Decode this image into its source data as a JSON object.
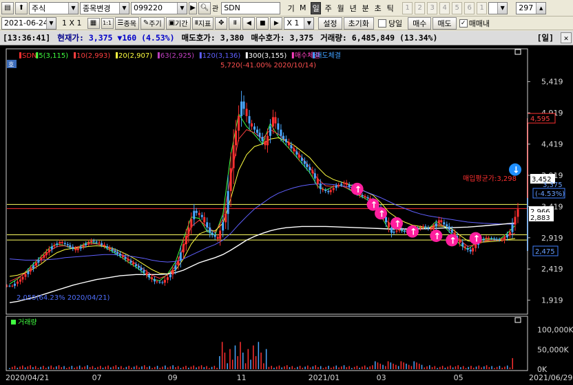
{
  "toolbar1": {
    "market": "주식",
    "change_label": "종목변경",
    "code": "099220",
    "ticker": "SDN",
    "mode_chars": [
      "기",
      "M"
    ],
    "periods": [
      {
        "label": "일",
        "active": true
      },
      {
        "label": "주",
        "active": false
      },
      {
        "label": "월",
        "active": false
      },
      {
        "label": "년",
        "active": false
      },
      {
        "label": "분",
        "active": false
      },
      {
        "label": "초",
        "active": false
      },
      {
        "label": "틱",
        "active": false
      }
    ],
    "nums": [
      "1",
      "2",
      "3",
      "4",
      "5",
      "6",
      "1"
    ],
    "count": "297"
  },
  "toolbar2": {
    "date": "2021-06-24",
    "layout": "1 X 1",
    "labels": [
      "종목",
      "주기",
      "기간",
      "지표"
    ],
    "ratio": "X 1",
    "settings": "설정",
    "reset": "초기화",
    "sameday": "당일",
    "buy": "매수",
    "sell": "매도",
    "trade": "매매내"
  },
  "status": {
    "time": "[13:36:41]",
    "price_label": "현재가:",
    "price": "3,375",
    "change": "▼160",
    "change_pct": "(4.53%)",
    "ask_label": "매도호가:",
    "ask": "3,380",
    "bid_label": "매수호가:",
    "bid": "3,375",
    "vol_label": "거래량:",
    "vol": "6,485,849",
    "vol_pct": "(13.34%)",
    "period": "[일]"
  },
  "legend": {
    "tag": "호",
    "items": [
      {
        "text": "SDN",
        "color": "#ff3030"
      },
      {
        "text": "5(3,115)",
        "color": "#40ff40"
      },
      {
        "text": "10(2,993)",
        "color": "#ff4040"
      },
      {
        "text": "20(2,907)",
        "color": "#ffff40"
      },
      {
        "text": "63(2,925)",
        "color": "#c040c0"
      },
      {
        "text": "120(3,136)",
        "color": "#6060ff"
      },
      {
        "text": "300(3,155)",
        "color": "#ffffff"
      },
      {
        "text": "매수체결",
        "color": "#ff40c0"
      },
      {
        "text": "매도체결",
        "color": "#40a0ff"
      }
    ]
  },
  "annotations": {
    "high": "5,720(-41.00% 2020/10/14)",
    "low": "2,055(64.23% 2020/04/21)",
    "avgline": "매입평균가:3,298",
    "volume_label": "거래량"
  },
  "chart_data": {
    "type": "candlestick",
    "title": "",
    "y_ticks": [
      "5,419",
      "4,919",
      "4,419",
      "3,919",
      "3,419",
      "2,919",
      "2,419",
      "1,919"
    ],
    "right_labels": {
      "max": "4,595",
      "line1": "3,452",
      "current": "3,375",
      "current_pct": "(-4.53%)",
      "line2": "2,966",
      "line3": "2,883",
      "min": "2,475"
    },
    "x_labels": [
      "2020/04/21",
      "07",
      "09",
      "11",
      "2021/01",
      "03",
      "05",
      "2021/06/29"
    ],
    "volume_ticks": [
      "100,000K",
      "50,000K",
      "0K"
    ],
    "ylim": [
      1750,
      5900
    ],
    "price_series": [
      2150,
      2250,
      2380,
      2520,
      2640,
      2780,
      2850,
      2800,
      2720,
      2800,
      2870,
      2830,
      2760,
      2690,
      2610,
      2520,
      2440,
      2320,
      2220,
      2200,
      2330,
      2550,
      2950,
      3350,
      3250,
      3000,
      2900,
      3300,
      4400,
      5100,
      4750,
      4600,
      4400,
      4850,
      4550,
      4400,
      4250,
      4100,
      3950,
      3700,
      3650,
      3750,
      3800,
      3700,
      3600,
      3550,
      3450,
      3250,
      3000,
      3050,
      3000,
      3050,
      3100,
      3050,
      3200,
      3100,
      2950,
      2780,
      2700,
      2860,
      2920,
      2900,
      2880,
      3010,
      3375
    ],
    "series": [
      {
        "name": "5(3,115)",
        "values": [
          2180,
          2260,
          2370,
          2500,
          2620,
          2750,
          2820,
          2790,
          2740,
          2790,
          2850,
          2830,
          2770,
          2700,
          2620,
          2530,
          2450,
          2350,
          2260,
          2230,
          2340,
          2530,
          2900,
          3250,
          3230,
          3020,
          2960,
          3300,
          4250,
          4900,
          4700,
          4570,
          4420,
          4750,
          4540,
          4400,
          4260,
          4110,
          3960,
          3740,
          3680,
          3740,
          3760,
          3690,
          3610,
          3550,
          3460,
          3270,
          3050,
          3060,
          3020,
          3050,
          3090,
          3060,
          3180,
          3100,
          2970,
          2810,
          2730,
          2840,
          2900,
          2900,
          2890,
          2990,
          3115
        ]
      },
      {
        "name": "10(2,993)",
        "values": [
          2220,
          2280,
          2350,
          2460,
          2580,
          2700,
          2780,
          2790,
          2760,
          2780,
          2820,
          2820,
          2790,
          2730,
          2660,
          2580,
          2500,
          2410,
          2320,
          2270,
          2320,
          2460,
          2760,
          3100,
          3200,
          3100,
          3000,
          3220,
          3900,
          4500,
          4650,
          4600,
          4500,
          4650,
          4580,
          4470,
          4340,
          4200,
          4050,
          3860,
          3750,
          3740,
          3750,
          3700,
          3640,
          3580,
          3500,
          3340,
          3150,
          3100,
          3050,
          3050,
          3070,
          3060,
          3140,
          3110,
          3020,
          2880,
          2780,
          2810,
          2860,
          2880,
          2880,
          2950,
          2993
        ]
      },
      {
        "name": "20(2,907)",
        "values": [
          2300,
          2320,
          2360,
          2420,
          2500,
          2600,
          2680,
          2730,
          2750,
          2760,
          2780,
          2790,
          2780,
          2750,
          2700,
          2640,
          2570,
          2490,
          2410,
          2350,
          2340,
          2400,
          2580,
          2820,
          2980,
          3030,
          3030,
          3150,
          3550,
          4000,
          4250,
          4380,
          4420,
          4500,
          4520,
          4470,
          4400,
          4300,
          4200,
          4050,
          3920,
          3850,
          3810,
          3770,
          3720,
          3660,
          3600,
          3480,
          3330,
          3240,
          3170,
          3120,
          3100,
          3080,
          3110,
          3100,
          3060,
          2960,
          2870,
          2850,
          2850,
          2860,
          2870,
          2890,
          2907
        ]
      },
      {
        "name": "120(3,136)",
        "values": [
          2580,
          2570,
          2560,
          2560,
          2560,
          2570,
          2580,
          2600,
          2610,
          2620,
          2630,
          2640,
          2650,
          2650,
          2640,
          2630,
          2610,
          2590,
          2560,
          2540,
          2530,
          2540,
          2580,
          2640,
          2700,
          2760,
          2810,
          2880,
          2990,
          3130,
          3260,
          3380,
          3470,
          3560,
          3630,
          3680,
          3720,
          3750,
          3770,
          3780,
          3780,
          3770,
          3750,
          3730,
          3700,
          3660,
          3610,
          3560,
          3500,
          3440,
          3390,
          3340,
          3300,
          3270,
          3250,
          3230,
          3210,
          3190,
          3170,
          3160,
          3150,
          3145,
          3140,
          3138,
          3136
        ]
      },
      {
        "name": "300(3,155)",
        "values": [
          1880,
          1900,
          1930,
          1960,
          2000,
          2040,
          2080,
          2120,
          2160,
          2190,
          2220,
          2250,
          2270,
          2290,
          2310,
          2320,
          2330,
          2330,
          2330,
          2330,
          2340,
          2360,
          2400,
          2460,
          2520,
          2560,
          2600,
          2650,
          2720,
          2800,
          2880,
          2940,
          2990,
          3030,
          3060,
          3080,
          3090,
          3100,
          3100,
          3100,
          3100,
          3095,
          3090,
          3085,
          3080,
          3075,
          3070,
          3065,
          3060,
          3060,
          3060,
          3060,
          3062,
          3065,
          3070,
          3075,
          3080,
          3085,
          3090,
          3100,
          3110,
          3120,
          3130,
          3145,
          3155
        ]
      }
    ],
    "buy_marker_prices": [
      3700,
      3450,
      3310,
      3150,
      3020,
      2950,
      2880,
      2910
    ],
    "sell_marker_prices": [
      3900
    ],
    "volume_max_k": 120000
  }
}
